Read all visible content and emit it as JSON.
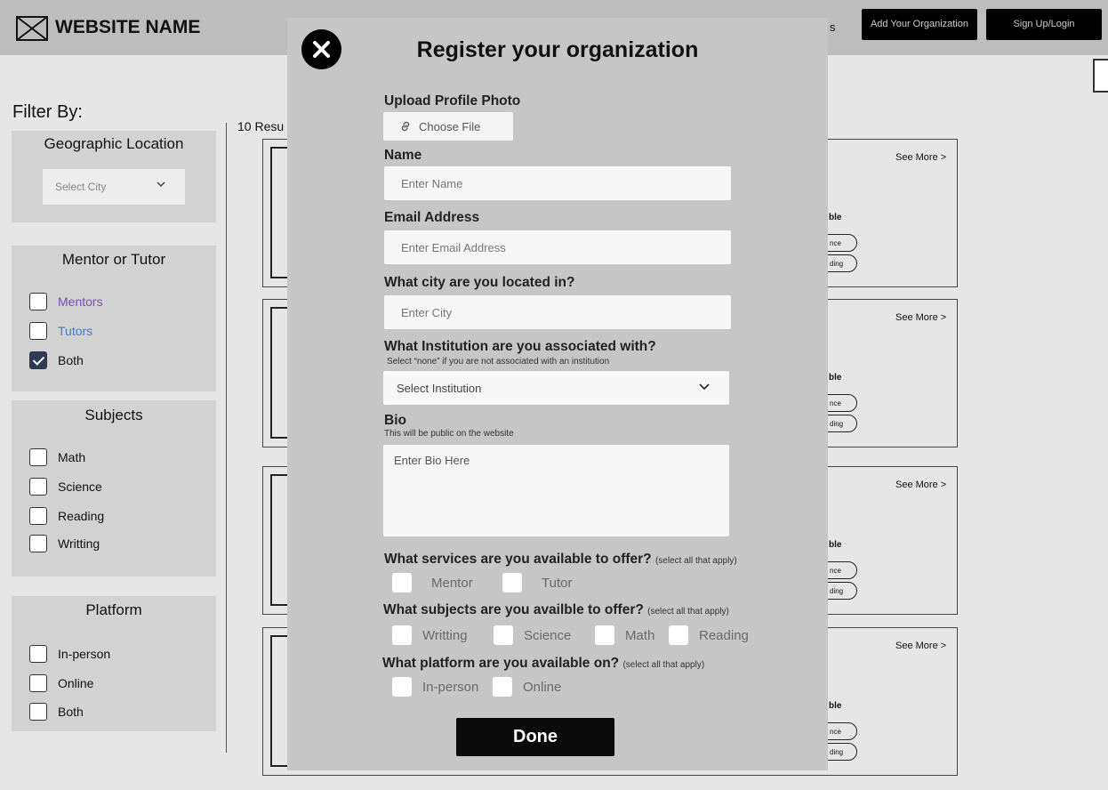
{
  "header": {
    "site_name": "WEBSITE NAME",
    "nav_fragment": "s",
    "add_org_button": "Add Your Organization",
    "signup_button": "Sign Up/Login"
  },
  "filters": {
    "title": "Filter By:",
    "location": {
      "title": "Geographic Location",
      "select_placeholder": "Select City"
    },
    "mentor_tutor": {
      "title": "Mentor or Tutor",
      "options": [
        {
          "label": "Mentors",
          "checked": false,
          "color": "#7a4cb8"
        },
        {
          "label": "Tutors",
          "checked": false,
          "color": "#4a78c8"
        },
        {
          "label": "Both",
          "checked": true,
          "color": "#222222"
        }
      ]
    },
    "subjects": {
      "title": "Subjects",
      "options": [
        "Math",
        "Science",
        "Reading",
        "Writting"
      ]
    },
    "platform": {
      "title": "Platform",
      "options": [
        "In-person",
        "Online",
        "Both"
      ]
    }
  },
  "results": {
    "count_text": "10 Resu",
    "cards": [
      {
        "see_more": "See More >",
        "label_frag": "ble",
        "pill_1": "nce",
        "pill_2": "ding"
      },
      {
        "see_more": "See More >",
        "label_frag": "ble",
        "pill_1": "nce",
        "pill_2": "ding"
      },
      {
        "see_more": "See More >",
        "label_frag": "ble",
        "pill_1": "nce",
        "pill_2": "ding"
      },
      {
        "see_more": "See More >",
        "label_frag": "ble",
        "pill_1": "nce",
        "pill_2": "ding"
      }
    ]
  },
  "modal": {
    "title": "Register your organization",
    "upload_label": "Upload Profile Photo",
    "choose_file": "Choose File",
    "name_label": "Name",
    "name_placeholder": "Enter Name",
    "email_label": "Email Address",
    "email_placeholder": "Enter Email Address",
    "city_label": "What city are you located in?",
    "city_placeholder": "Enter City",
    "institution_label": "What Institution are you associated with?",
    "institution_hint": "Select “none” if you are not associated with an institution",
    "institution_select": "Select Institution",
    "bio_label": "Bio",
    "bio_hint": "This will be public on the website",
    "bio_placeholder": "Enter Bio Here",
    "services_label": "What services are you available to offer?",
    "services_hint": "(select all that apply)",
    "services": [
      "Mentor",
      "Tutor"
    ],
    "subjects_label": "What subjects are you availble to offer?",
    "subjects_hint": "(select all that apply)",
    "subjects": [
      "Writting",
      "Science",
      "Math",
      "Reading"
    ],
    "platform_label": "What platform are you available on?",
    "platform_hint": "(select all that apply)",
    "platforms": [
      "In-person",
      "Online"
    ],
    "done_button": "Done"
  }
}
